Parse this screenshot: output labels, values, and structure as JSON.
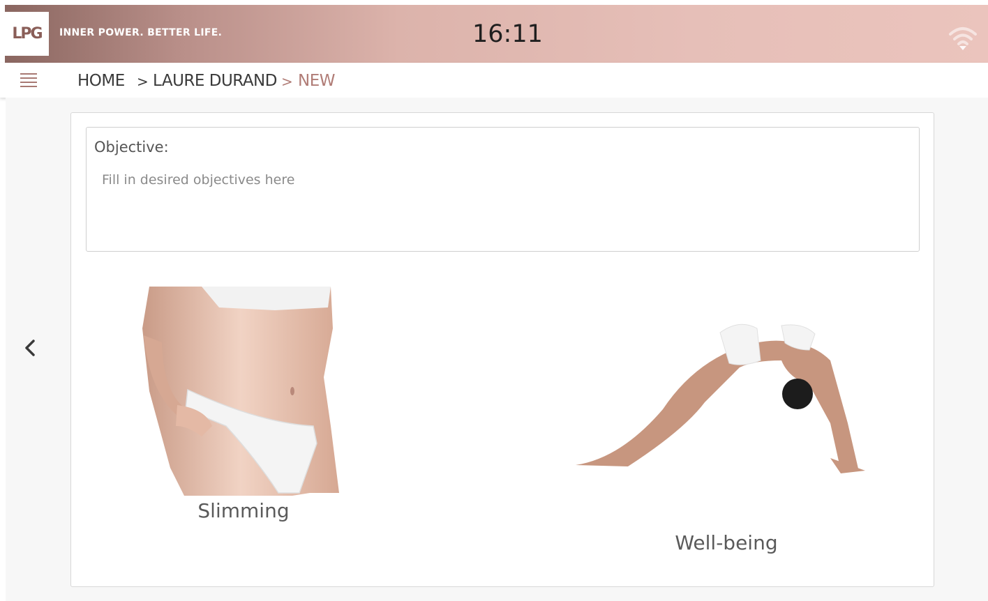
{
  "header": {
    "logo": "LPG",
    "tagline": "INNER POWER. BETTER LIFE.",
    "time": "16:11",
    "wifi_icon": "wifi-icon"
  },
  "nav": {
    "menu_icon": "hamburger-menu-icon",
    "breadcrumb": [
      "HOME",
      "LAURE DURAND",
      "NEW"
    ],
    "separator": ">"
  },
  "objective": {
    "label": "Objective:",
    "placeholder": "Fill in desired objectives here",
    "value": ""
  },
  "tiles": [
    {
      "label": "Slimming",
      "image": "slimming-photo"
    },
    {
      "label": "Well-being",
      "image": "well-being-photo"
    }
  ],
  "colors": {
    "accent": "#b07c76",
    "header_start": "#8a6660",
    "header_end": "#ebc4bd"
  }
}
